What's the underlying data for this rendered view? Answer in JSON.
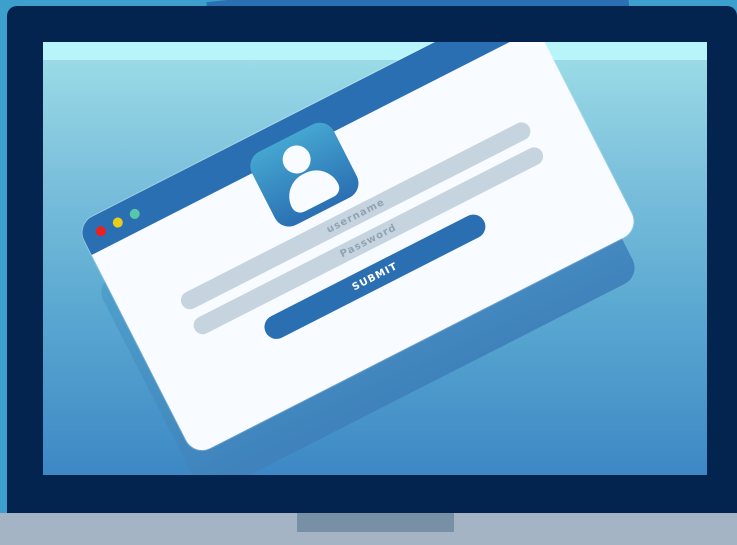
{
  "scene": {
    "window_controls": [
      "red-dot",
      "yellow-dot",
      "green-dot"
    ],
    "avatar_icon": "user-icon"
  },
  "login_form": {
    "username_label": "username",
    "password_label": "Password",
    "submit_label": "SUBMIT"
  }
}
